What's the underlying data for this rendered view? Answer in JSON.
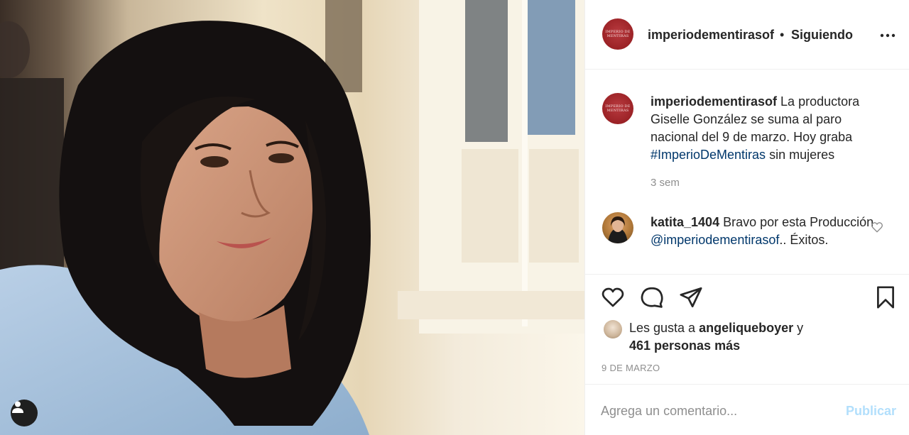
{
  "post": {
    "account": "imperiodementirasof",
    "avatar_text_line1": "IMPERIO DE",
    "avatar_text_line2": "MENTIRAS",
    "separator": "•",
    "follow_status": "Siguiendo",
    "more_icon": "more-horizontal-icon"
  },
  "caption": {
    "username": "imperiodementirasof",
    "text_before_hashtag": " La productora Giselle González se suma al paro nacional del 9 de marzo. Hoy graba ",
    "hashtag": "#ImperioDeMentiras",
    "text_after_hashtag": " sin mujeres",
    "time": "3 sem"
  },
  "comment": {
    "username": "katita_1404",
    "text_before_mention": " Bravo por esta Producción ",
    "mention": "@imperiodementirasof",
    "text_after_mention": ".. Éxitos."
  },
  "likes": {
    "prefix": "Les gusta a ",
    "liker": "angeliqueboyer",
    "middle": " y",
    "others": "461 personas más"
  },
  "date": "9 DE MARZO",
  "composer": {
    "placeholder": "Agrega un comentario...",
    "publish_label": "Publicar"
  },
  "colors": {
    "link": "#00376b",
    "muted": "#8e8e8e",
    "publish_disabled": "#b2dffc",
    "brand_red": "#9b2226"
  }
}
